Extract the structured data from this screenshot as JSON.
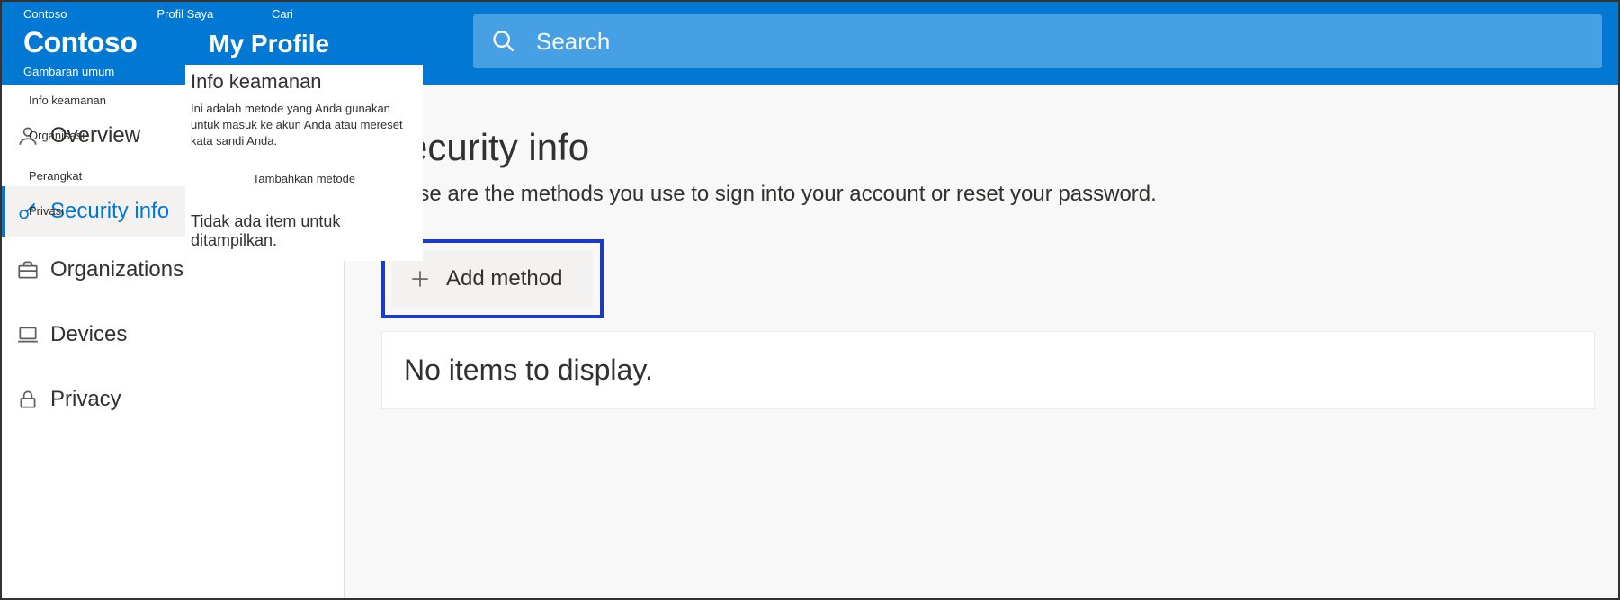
{
  "header": {
    "small_labels": {
      "brand": "Contoso",
      "profile": "Profil Saya",
      "search": "Cari"
    },
    "brand": "Contoso",
    "section": "My Profile",
    "overview_small": "Gambaran umum"
  },
  "search": {
    "placeholder": "Search"
  },
  "overlay": {
    "title": "Info keamanan",
    "description": "Ini adalah metode yang Anda gunakan untuk masuk ke akun Anda atau mereset kata sandi Anda.",
    "add_label": "Tambahkan metode",
    "no_items": "Tidak ada item untuk ditampilkan."
  },
  "sidebar": {
    "labels": {
      "info_keamanan": "Info keamanan",
      "organisasi": "Organisasi",
      "perangkat": "Perangkat",
      "privasi": "Privasi"
    },
    "items": {
      "overview": "Overview",
      "security": "Security info",
      "organizations": "Organizations",
      "devices": "Devices",
      "privacy": "Privacy"
    }
  },
  "main": {
    "title": "Security info",
    "subtitle": "These are the methods you use to sign into your account or reset your password.",
    "add_method": "Add method",
    "no_items": "No items to display."
  }
}
